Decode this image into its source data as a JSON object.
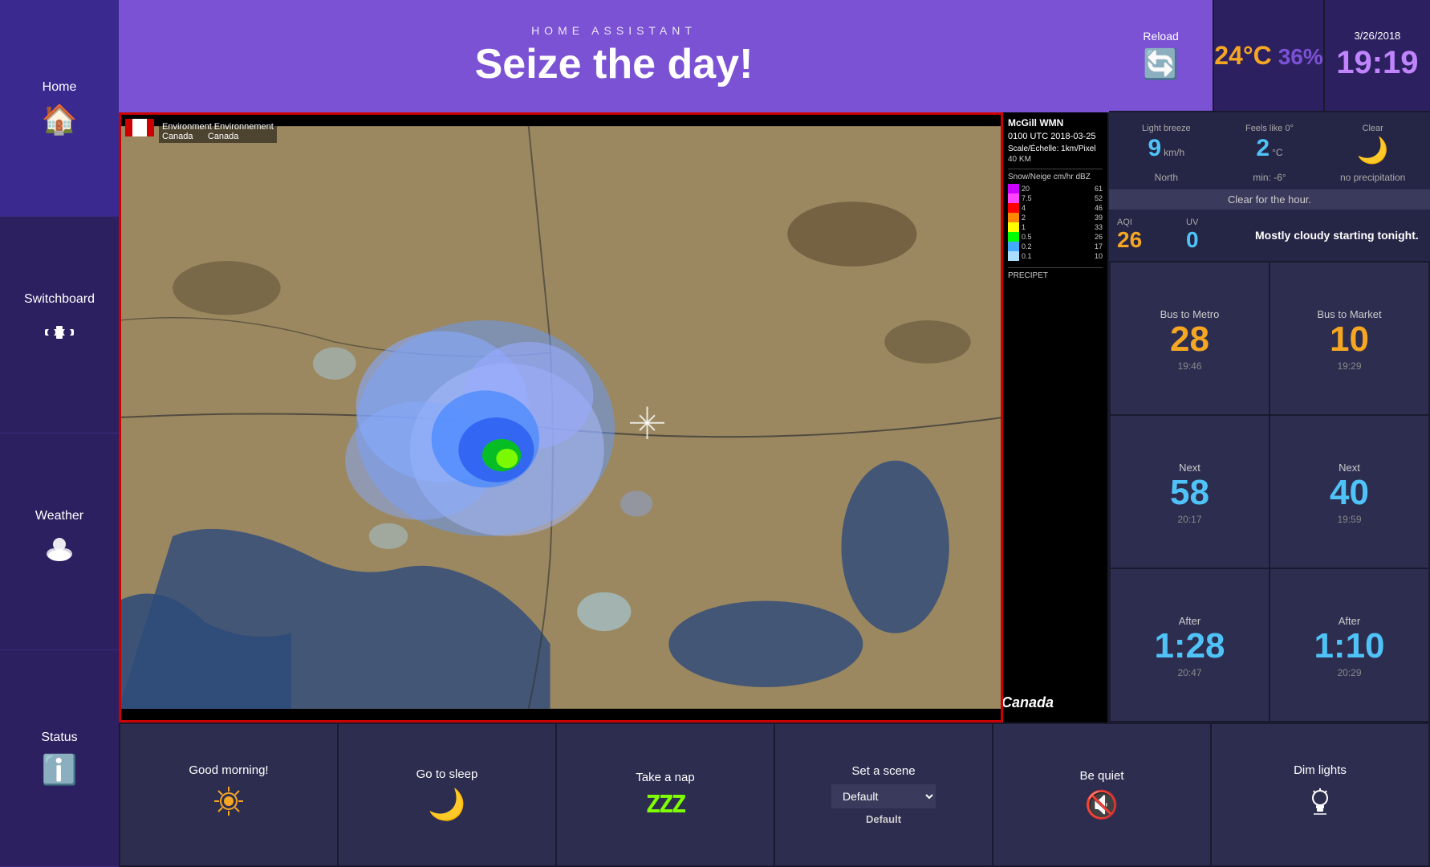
{
  "sidebar": {
    "items": [
      {
        "id": "home",
        "label": "Home",
        "icon": "🏠"
      },
      {
        "id": "switchboard",
        "label": "Switchboard",
        "icon": "🎮"
      },
      {
        "id": "weather",
        "label": "Weather",
        "icon": "⛅"
      },
      {
        "id": "status",
        "label": "Status",
        "icon": "ℹ️"
      }
    ]
  },
  "header": {
    "subtitle": "HOME ASSISTANT",
    "title": "Seize the day!"
  },
  "topright": {
    "reload_label": "Reload",
    "reload_icon": "🔄",
    "temperature": "24°C",
    "humidity": "36%",
    "date": "3/26/2018",
    "time": "19:19"
  },
  "weather": {
    "wind_label": "Light breeze",
    "wind_value": "9",
    "wind_unit": "km/h",
    "wind_dir": "North",
    "feels_label": "Feels like 0°",
    "feels_value": "2",
    "feels_unit": "°C",
    "feels_min": "min: -6°",
    "condition_label": "Clear",
    "condition_icon": "🌙",
    "condition_sub": "no precipitation",
    "summary_bar": "Clear for the hour.",
    "aqi_label": "AQI",
    "aqi_value": "26",
    "uv_label": "UV",
    "uv_value": "0",
    "forecast": "Mostly cloudy starting tonight."
  },
  "bus": {
    "cards": [
      {
        "title": "Bus to Metro",
        "number": "28",
        "time": "19:46",
        "color": "orange"
      },
      {
        "title": "Bus to Market",
        "number": "10",
        "time": "19:29",
        "color": "orange"
      },
      {
        "title": "Next",
        "number": "58",
        "time": "20:17",
        "color": "cyan"
      },
      {
        "title": "Next",
        "number": "40",
        "time": "19:59",
        "color": "cyan"
      },
      {
        "title": "After",
        "number": "1:28",
        "time": "20:47",
        "color": "cyan"
      },
      {
        "title": "After",
        "number": "1:10",
        "time": "20:29",
        "color": "cyan"
      }
    ]
  },
  "actions": [
    {
      "id": "good-morning",
      "label": "Good morning!",
      "icon": "☀"
    },
    {
      "id": "go-to-sleep",
      "label": "Go to sleep",
      "icon": "🌙"
    },
    {
      "id": "take-a-nap",
      "label": "Take a nap",
      "icon": "ZZZ"
    },
    {
      "id": "set-a-scene",
      "label": "Set a scene",
      "select": "Default",
      "options": [
        "Default"
      ]
    },
    {
      "id": "be-quiet",
      "label": "Be quiet",
      "icon": "🔇"
    },
    {
      "id": "dim-lights",
      "label": "Dim lights",
      "icon": "💡"
    }
  ],
  "radar": {
    "station": "McGill WMN",
    "time": "0100 UTC 2018-03-25",
    "scale": "Scale/Échelle: 1km/Pixel",
    "km": "40 KM",
    "legend_title": "Snow/Neige cm/hr dBZ",
    "legend_items": [
      {
        "label": "20",
        "dbz": "61",
        "color": "#cc00ff"
      },
      {
        "label": "7.5",
        "dbz": "52",
        "color": "#ff44ff"
      },
      {
        "label": "4",
        "dbz": "46",
        "color": "#ff0000"
      },
      {
        "label": "2",
        "dbz": "39",
        "color": "#ff8800"
      },
      {
        "label": "1",
        "dbz": "33",
        "color": "#ffff00"
      },
      {
        "label": "0.5",
        "dbz": "26",
        "color": "#00ff00"
      },
      {
        "label": "0.2",
        "dbz": "17",
        "color": "#44aaff"
      },
      {
        "label": "0.1",
        "dbz": "10",
        "color": "#aaddff"
      }
    ],
    "precipet": "PRECIPET"
  }
}
